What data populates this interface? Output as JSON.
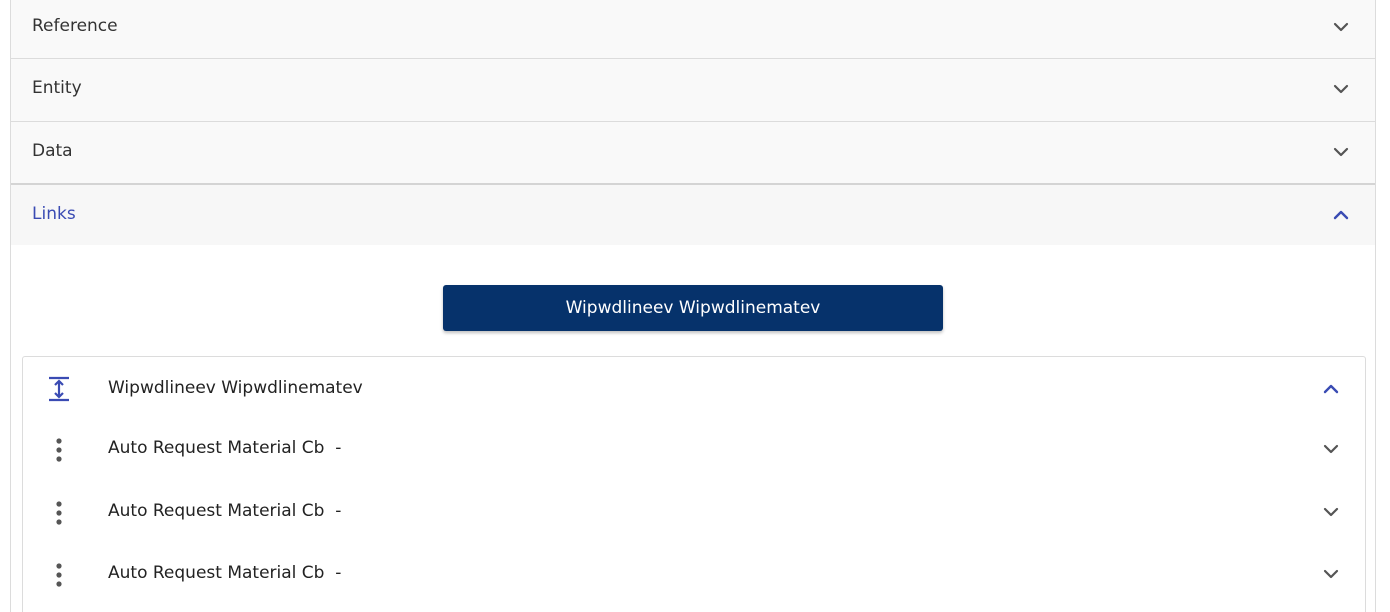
{
  "accordion": {
    "reference": {
      "label": "Reference",
      "icon": "chevron-down-icon"
    },
    "entity": {
      "label": "Entity",
      "icon": "chevron-down-icon"
    },
    "data": {
      "label": "Data",
      "icon": "chevron-down-icon"
    },
    "links": {
      "label": "Links",
      "icon": "chevron-up-icon",
      "expanded": true
    }
  },
  "links_section": {
    "primary_button_label": "Wipwdlineev Wipwdlinematev",
    "tree": {
      "root": {
        "label": "Wipwdlineev Wipwdlinematev",
        "icon": "expand-vertical-icon",
        "expanded": true
      },
      "items": [
        {
          "label": "Auto Request Material Cb  -",
          "icon": "more-vert-icon"
        },
        {
          "label": "Auto Request Material Cb  -",
          "icon": "more-vert-icon"
        },
        {
          "label": "Auto Request Material Cb  -",
          "icon": "more-vert-icon"
        }
      ]
    }
  },
  "colors": {
    "accent": "#3a4bb3",
    "primary_button": "#06326b",
    "header_bg": "#f9f9f9",
    "border": "#dcdcdc",
    "chevron_gray": "#555555"
  }
}
